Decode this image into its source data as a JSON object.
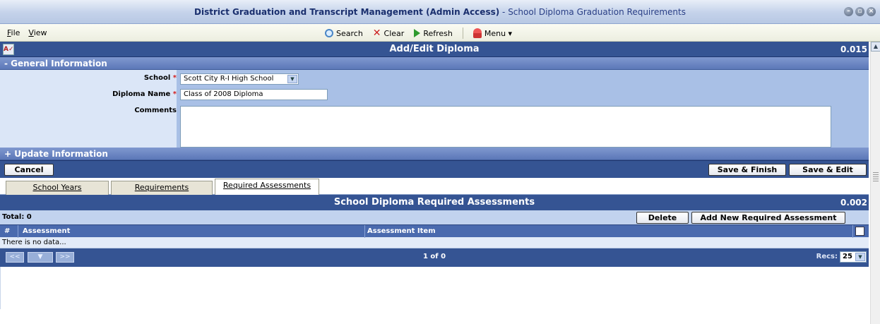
{
  "window": {
    "title_main": "District Graduation and Transcript Management (Admin Access)",
    "title_sub": "- School Diploma Graduation Requirements"
  },
  "menu": {
    "file": "File",
    "view": "View"
  },
  "toolbar": {
    "search": "Search",
    "clear": "Clear",
    "refresh": "Refresh",
    "menu": "Menu ▾"
  },
  "form_header": {
    "title": "Add/Edit Diploma",
    "timer": "0.015"
  },
  "general_section": {
    "label": "- General Information"
  },
  "fields": {
    "school_label": "School",
    "school_value": "Scott City R-I High School",
    "diploma_label": "Diploma Name",
    "diploma_value": "Class of 2008 Diploma",
    "comments_label": "Comments",
    "comments_value": "",
    "required_mark": "*"
  },
  "update_section": {
    "label": "+ Update Information"
  },
  "buttons": {
    "cancel": "Cancel",
    "save_finish": "Save & Finish",
    "save_edit": "Save & Edit"
  },
  "tabs": [
    "School Years",
    "Requirements",
    "Required Assessments"
  ],
  "grid": {
    "title": "School Diploma Required Assessments",
    "timer": "0.002",
    "total": "Total: 0",
    "delete": "Delete",
    "add_new": "Add New Required Assessment",
    "col_num": "#",
    "col_assessment": "Assessment",
    "col_item": "Assessment Item",
    "no_data": "There is no data...",
    "pager_prev": "<<",
    "pager_next": ">>",
    "pages": "1 of 0",
    "recs_label": "Recs:",
    "recs_value": "25"
  }
}
